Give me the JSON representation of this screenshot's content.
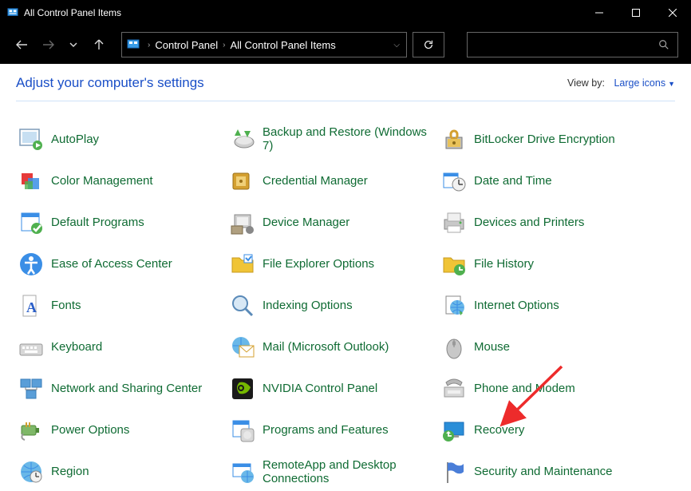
{
  "window": {
    "title": "All Control Panel Items"
  },
  "breadcrumb": {
    "seg1": "Control Panel",
    "seg2": "All Control Panel Items"
  },
  "header": {
    "adjust": "Adjust your computer's settings",
    "viewby_label": "View by:",
    "viewby_value": "Large icons"
  },
  "items": [
    {
      "label": "AutoPlay"
    },
    {
      "label": "Backup and Restore (Windows 7)"
    },
    {
      "label": "BitLocker Drive Encryption"
    },
    {
      "label": "Color Management"
    },
    {
      "label": "Credential Manager"
    },
    {
      "label": "Date and Time"
    },
    {
      "label": "Default Programs"
    },
    {
      "label": "Device Manager"
    },
    {
      "label": "Devices and Printers"
    },
    {
      "label": "Ease of Access Center"
    },
    {
      "label": "File Explorer Options"
    },
    {
      "label": "File History"
    },
    {
      "label": "Fonts"
    },
    {
      "label": "Indexing Options"
    },
    {
      "label": "Internet Options"
    },
    {
      "label": "Keyboard"
    },
    {
      "label": "Mail (Microsoft Outlook)"
    },
    {
      "label": "Mouse"
    },
    {
      "label": "Network and Sharing Center"
    },
    {
      "label": "NVIDIA Control Panel"
    },
    {
      "label": "Phone and Modem"
    },
    {
      "label": "Power Options"
    },
    {
      "label": "Programs and Features"
    },
    {
      "label": "Recovery"
    },
    {
      "label": "Region"
    },
    {
      "label": "RemoteApp and Desktop Connections"
    },
    {
      "label": "Security and Maintenance"
    }
  ]
}
